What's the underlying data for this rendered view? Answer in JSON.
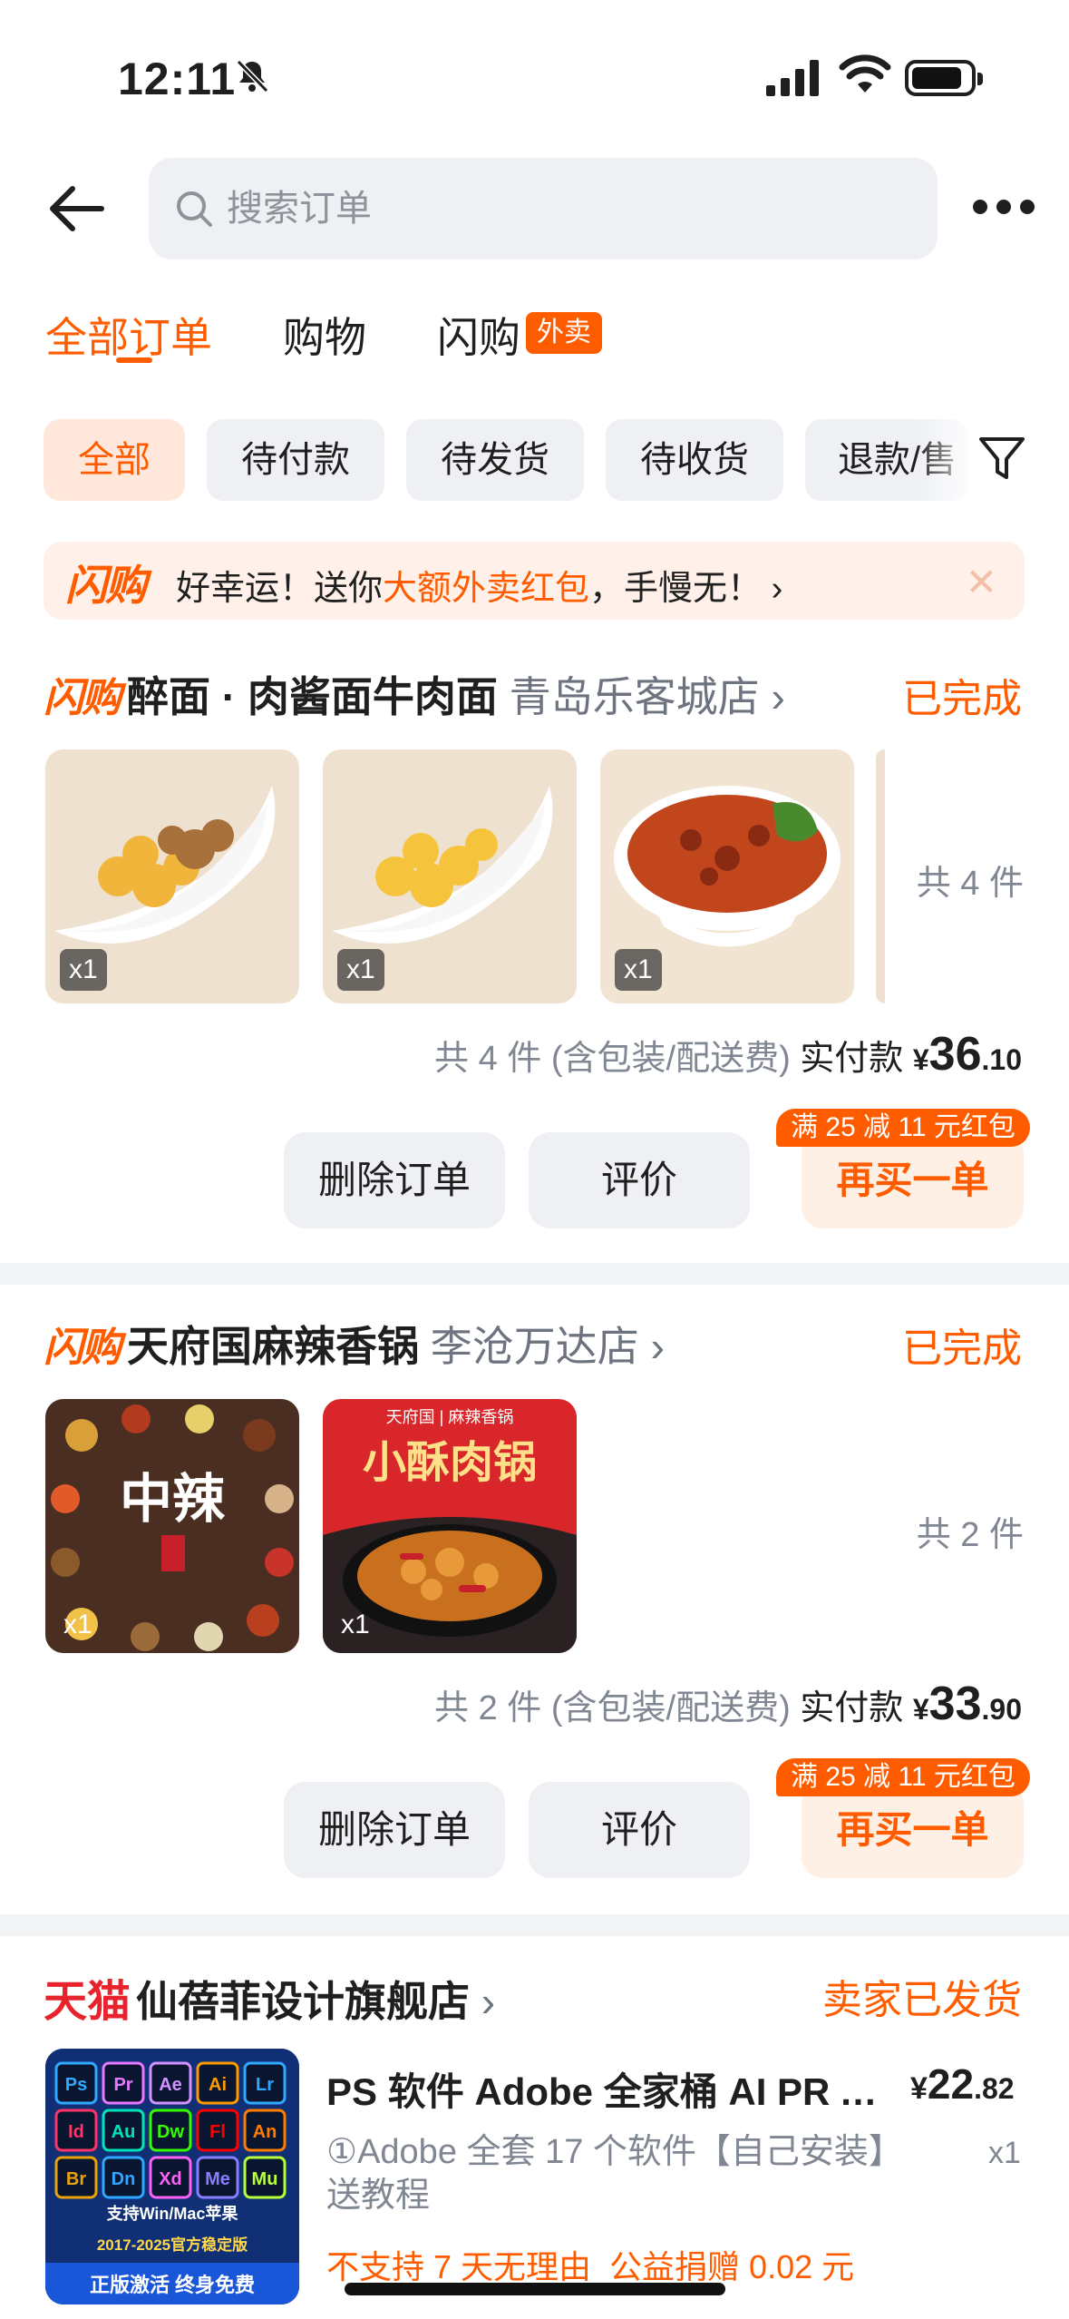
{
  "status_bar": {
    "time": "12:11"
  },
  "search": {
    "placeholder": "搜索订单"
  },
  "top_tabs": [
    {
      "label": "全部订单",
      "active": true
    },
    {
      "label": "购物"
    },
    {
      "label": "闪购",
      "badge": "外卖"
    }
  ],
  "chips": [
    "全部",
    "待付款",
    "待发货",
    "待收货",
    "退款/售"
  ],
  "banner": {
    "logo": "闪购",
    "text_1": "好幸运！送你",
    "text_highlight": "大额外卖红包",
    "text_2": "，手慢无！",
    "chevron": "›",
    "close": "✕"
  },
  "orders": [
    {
      "logo": "闪购",
      "shop_name": "醉面 · 肉酱面牛肉面",
      "branch": "青岛乐客城店",
      "chevron": "›",
      "status": "已完成",
      "items": [
        {
          "qty": "x1"
        },
        {
          "qty": "x1"
        },
        {
          "qty": "x1"
        }
      ],
      "count_label": "共 4 件",
      "summary": "共 4 件 (含包装/配送费)",
      "pay_label": "实付款",
      "currency": "¥",
      "amount_int": "36",
      "amount_dec": ".10",
      "actions": [
        "删除订单",
        "评价",
        "再买一单"
      ],
      "promo": "满 25 减 11 元红包"
    },
    {
      "logo": "闪购",
      "shop_name": "天府国麻辣香锅",
      "branch": "李沧万达店",
      "chevron": "›",
      "status": "已完成",
      "items": [
        {
          "qty": "x1",
          "art_text": "中辣"
        },
        {
          "qty": "x1",
          "art_text": "小酥肉锅",
          "art_brand": "天府国 | 麻辣香锅"
        }
      ],
      "count_label": "共 2 件",
      "summary": "共 2 件 (含包装/配送费)",
      "pay_label": "实付款",
      "currency": "¥",
      "amount_int": "33",
      "amount_dec": ".90",
      "actions": [
        "删除订单",
        "评价",
        "再买一单"
      ],
      "promo": "满 25 减 11 元红包"
    },
    {
      "logo": "天猫",
      "shop_name": "仙蓓菲设计旗舰店",
      "chevron": "›",
      "status": "卖家已发货",
      "product": {
        "title": "PS 软件 Adobe 全家桶 AI PR AE...",
        "currency": "¥",
        "amount_int": "22",
        "amount_dec": ".82",
        "sku": "①Adobe 全套 17 个软件【自己安装】送教程",
        "qty": "x1",
        "tag_1": "不支持 7 天无理由",
        "tag_2": "公益捐赠 0.02 元",
        "art": {
          "icons": [
            "Ps",
            "Pr",
            "Ae",
            "Ai",
            "Lr",
            "Id",
            "Au",
            "Dw",
            "Fl",
            "An",
            "Br",
            "Dn",
            "Xd",
            "Me",
            "Mu"
          ],
          "line1": "支持Win/Mac苹果",
          "line2": "2017-2025官方稳定版",
          "line3": "正版激活 终身免费"
        }
      }
    }
  ]
}
